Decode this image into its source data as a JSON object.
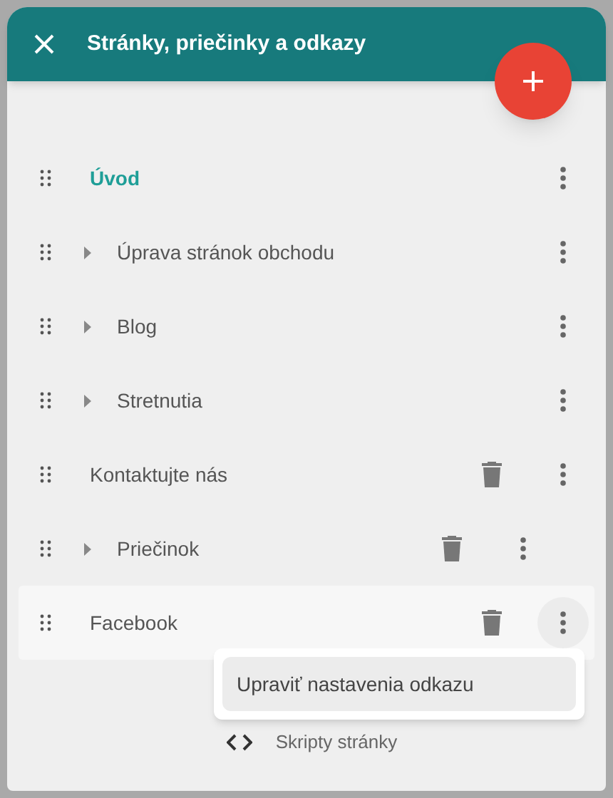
{
  "header": {
    "title": "Stránky, priečinky a odkazy"
  },
  "items": [
    {
      "label": "Úvod",
      "kind": "page",
      "selected": true,
      "expandable": false,
      "deletable": false,
      "menu_open": false
    },
    {
      "label": "Úprava stránok obchodu",
      "kind": "page",
      "selected": false,
      "expandable": true,
      "deletable": false,
      "menu_open": false
    },
    {
      "label": "Blog",
      "kind": "page",
      "selected": false,
      "expandable": true,
      "deletable": false,
      "menu_open": false
    },
    {
      "label": "Stretnutia",
      "kind": "page",
      "selected": false,
      "expandable": true,
      "deletable": false,
      "menu_open": false
    },
    {
      "label": "Kontaktujte nás",
      "kind": "page",
      "selected": false,
      "expandable": false,
      "deletable": true,
      "menu_open": false
    },
    {
      "label": "Priečinok",
      "kind": "folder",
      "selected": false,
      "expandable": true,
      "deletable": true,
      "menu_open": false
    },
    {
      "label": "Facebook",
      "kind": "link",
      "selected": false,
      "expandable": false,
      "deletable": true,
      "menu_open": true,
      "menu": [
        "Upraviť nastavenia odkazu"
      ]
    }
  ],
  "footer": {
    "label": "Skripty stránky"
  }
}
